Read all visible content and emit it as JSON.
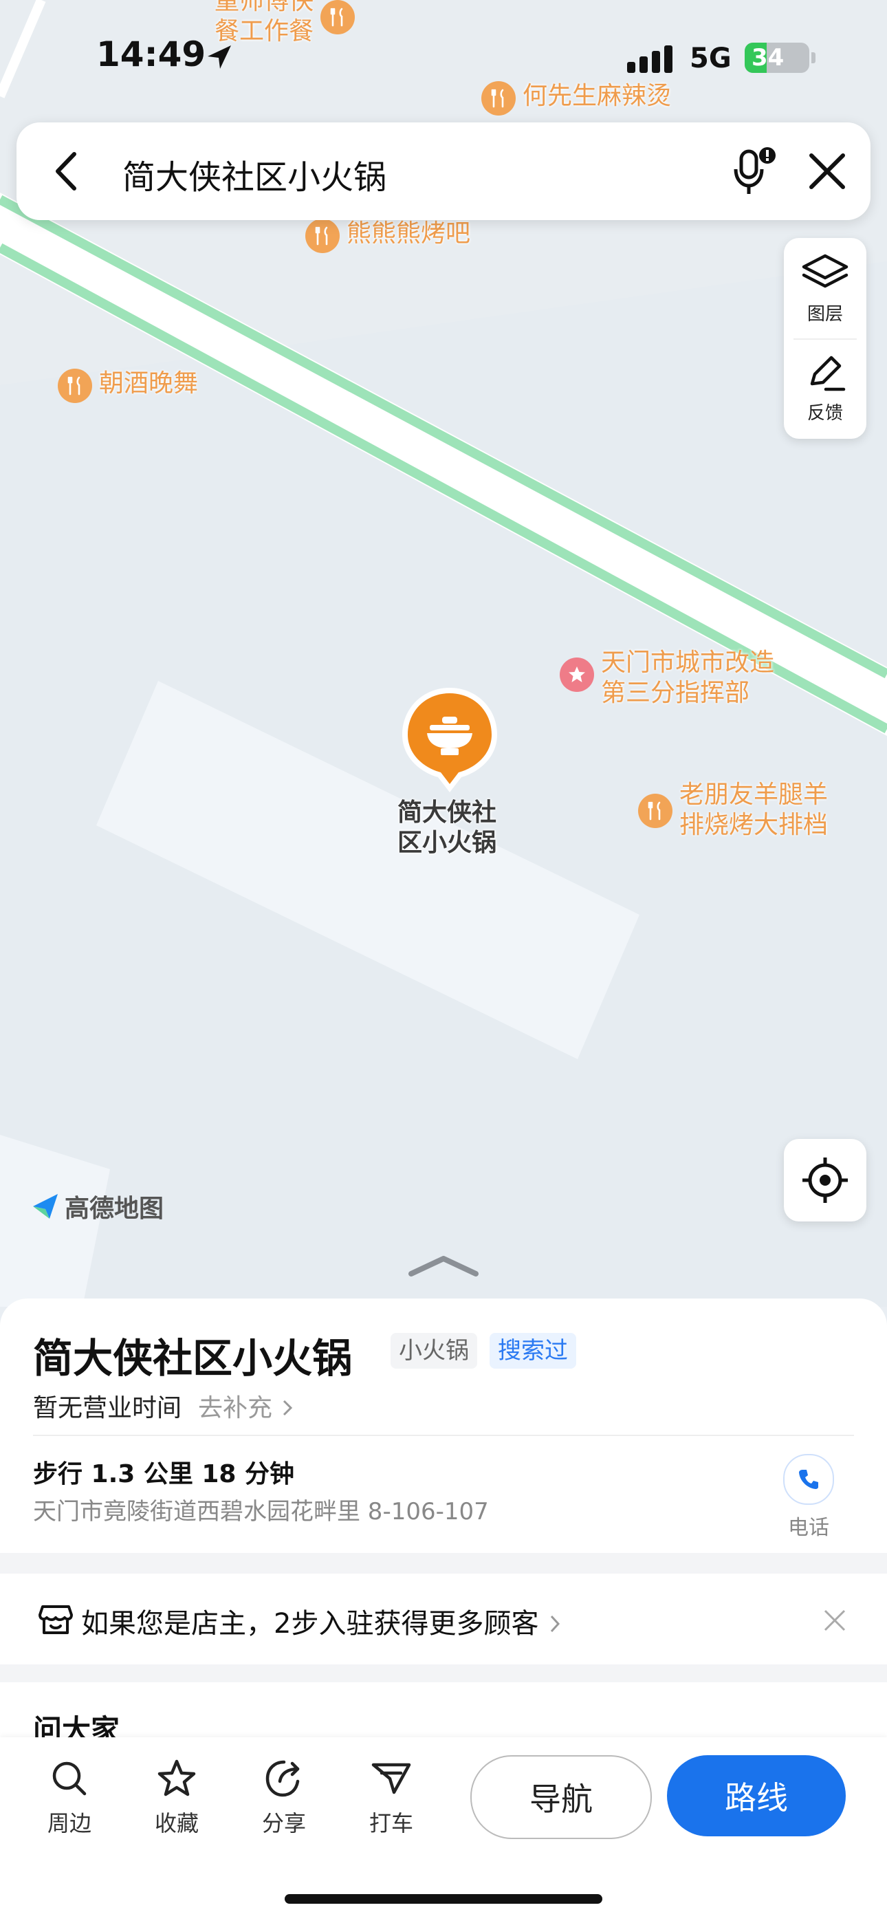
{
  "status_bar": {
    "time": "14:49",
    "network": "5G",
    "battery": "34",
    "battery_level": 0.34
  },
  "search": {
    "query": "简大侠社区小火锅",
    "icons": {
      "back": "chevron-left-icon",
      "mic": "microphone-icon",
      "close": "close-icon"
    }
  },
  "map_tools": {
    "layers_label": "图层",
    "feedback_label": "反馈"
  },
  "pois": [
    {
      "name": "童师傅快\n餐工作餐",
      "kind": "restaurant"
    },
    {
      "name": "何先生麻辣烫",
      "kind": "restaurant"
    },
    {
      "name": "熊熊熊烤吧",
      "kind": "restaurant"
    },
    {
      "name": "朝酒晚舞",
      "kind": "restaurant"
    },
    {
      "name": "天门市城市改造\n第三分指挥部",
      "kind": "government"
    },
    {
      "name": "老朋友羊腿羊\n排烧烤大排档",
      "kind": "restaurant"
    }
  ],
  "pin": {
    "label": "简大侠社\n区小火锅",
    "icon": "hotpot-icon"
  },
  "map_brand": "高德地图",
  "place": {
    "title": "简大侠社区小火锅",
    "category_tag": "小火锅",
    "history_tag": "搜索过",
    "hours": "暂无营业时间",
    "hours_add": "去补充",
    "distance": "步行 1.3 公里 18 分钟",
    "address": "天门市竟陵街道西碧水园花畔里 8-106-107",
    "phone_label": "电话"
  },
  "owner_banner": {
    "text": "如果您是店主，2步入驻获得更多顾客"
  },
  "ask_section": {
    "title": "问大家"
  },
  "toolbar": {
    "items": [
      {
        "label": "周边",
        "icon": "search-icon"
      },
      {
        "label": "收藏",
        "icon": "star-icon"
      },
      {
        "label": "分享",
        "icon": "share-icon"
      },
      {
        "label": "打车",
        "icon": "taxi-icon"
      }
    ],
    "navigate_label": "导航",
    "route_label": "路线"
  },
  "colors": {
    "accent": "#1a73ec",
    "poi_orange": "#ef9c4c",
    "road_green": "#8fe0b0",
    "pin_orange": "#f08a1c"
  }
}
